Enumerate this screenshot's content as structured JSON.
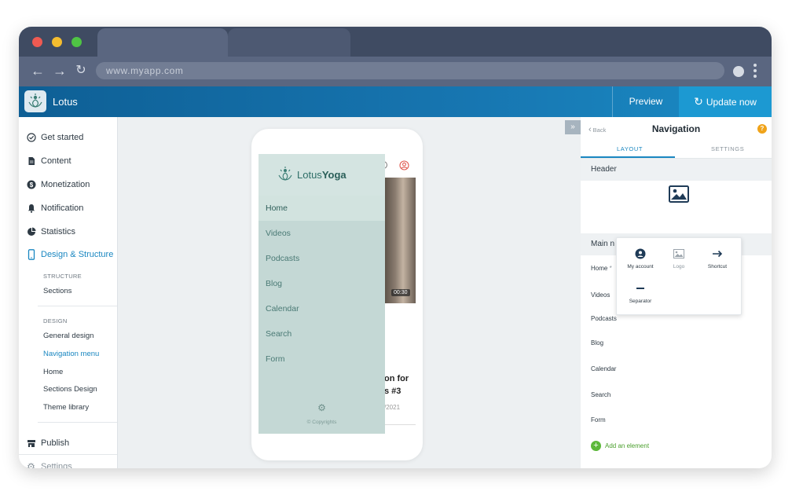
{
  "browser": {
    "url": "www.myapp.com",
    "traffic_colors": {
      "close": "#ef5a52",
      "minimize": "#f5bd2f",
      "maximize": "#4fc444"
    }
  },
  "app": {
    "name": "Lotus",
    "preview_label": "Preview",
    "update_label": "Update now"
  },
  "sidebar": {
    "items": [
      {
        "label": "Get started",
        "icon": "check-circle-icon"
      },
      {
        "label": "Content",
        "icon": "document-icon"
      },
      {
        "label": "Monetization",
        "icon": "dollar-icon"
      },
      {
        "label": "Notification",
        "icon": "bell-icon"
      },
      {
        "label": "Statistics",
        "icon": "pie-chart-icon"
      },
      {
        "label": "Design & Structure",
        "icon": "phone-icon"
      }
    ],
    "structure_caption": "STRUCTURE",
    "structure_items": [
      "Sections"
    ],
    "design_caption": "DESIGN",
    "design_items": [
      "General design",
      "Navigation menu",
      "Home",
      "Sections Design",
      "Theme library"
    ],
    "publish_label": "Publish",
    "settings_label": "Settings"
  },
  "phone": {
    "brand_light": "Lotus",
    "brand_bold": "Yoga",
    "menu": [
      "Home",
      "Videos",
      "Podcasts",
      "Blog",
      "Calendar",
      "Search",
      "Form"
    ],
    "copyright": "© Copyrights",
    "video_duration": "00:30",
    "bg_text_1": "e",
    "bg_text_2": "on for",
    "bg_text_3": "s #3",
    "bg_date": "/2021"
  },
  "panel": {
    "back_label": "Back",
    "title": "Navigation",
    "help": "?",
    "tabs": [
      "LAYOUT",
      "SETTINGS"
    ],
    "header_label": "Header",
    "main_label": "Main n",
    "items": [
      "Home",
      "Videos",
      "Podcasts",
      "Blog",
      "Calendar",
      "Search",
      "Form"
    ],
    "home_marker": "*",
    "add_label": "Add an element"
  },
  "popup": {
    "items": [
      {
        "label": "My account",
        "icon": "user-icon"
      },
      {
        "label": "Logo",
        "icon": "image-icon"
      },
      {
        "label": "Shortcut",
        "icon": "arrow-right-icon"
      },
      {
        "label": "Separator",
        "icon": "separator-icon"
      }
    ]
  }
}
